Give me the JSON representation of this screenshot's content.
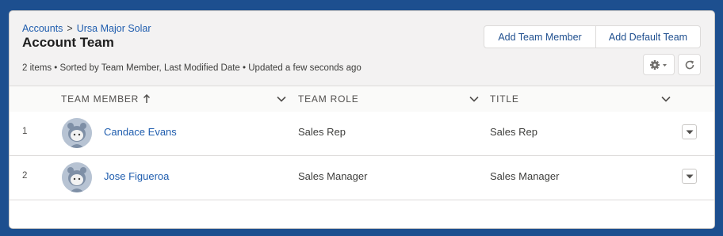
{
  "breadcrumb": {
    "parent": "Accounts",
    "separator": ">",
    "current": "Ursa Major Solar"
  },
  "page": {
    "title": "Account Team",
    "summary": "2 items • Sorted by Team Member, Last Modified Date • Updated a few seconds ago"
  },
  "actions": {
    "add_member": "Add Team Member",
    "add_default": "Add Default Team"
  },
  "icons": {
    "settings": "gear-icon",
    "refresh": "refresh-icon",
    "sort": "arrow-up-icon",
    "chevron": "chevron-down-icon"
  },
  "table": {
    "columns": [
      {
        "label": "TEAM MEMBER",
        "sorted": "ascending"
      },
      {
        "label": "TEAM ROLE"
      },
      {
        "label": "TITLE"
      }
    ],
    "rows": [
      {
        "num": "1",
        "member": "Candace Evans",
        "role": "Sales Rep",
        "title": "Sales Rep"
      },
      {
        "num": "2",
        "member": "Jose Figueroa",
        "role": "Sales Manager",
        "title": "Sales Manager"
      }
    ]
  },
  "colors": {
    "link": "#1f5dae",
    "background": "#1d4f8f",
    "panel": "#f3f2f2"
  }
}
